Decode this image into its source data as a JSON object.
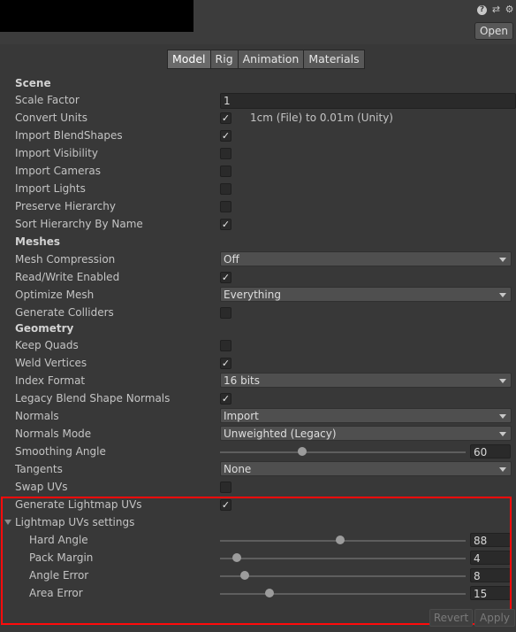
{
  "header": {
    "open_label": "Open",
    "help_icon": "?",
    "preset_icon": "⇄",
    "settings_icon": "⚙"
  },
  "tabs": [
    "Model",
    "Rig",
    "Animation",
    "Materials"
  ],
  "scene": {
    "heading": "Scene",
    "scale_factor": {
      "label": "Scale Factor",
      "value": "1"
    },
    "convert_units": {
      "label": "Convert Units",
      "checked": true,
      "note": "1cm (File) to 0.01m (Unity)"
    },
    "import_blendshapes": {
      "label": "Import BlendShapes",
      "checked": true
    },
    "import_visibility": {
      "label": "Import Visibility",
      "checked": false
    },
    "import_cameras": {
      "label": "Import Cameras",
      "checked": false
    },
    "import_lights": {
      "label": "Import Lights",
      "checked": false
    },
    "preserve_hierarchy": {
      "label": "Preserve Hierarchy",
      "checked": false
    },
    "sort_hierarchy": {
      "label": "Sort Hierarchy By Name",
      "checked": true
    }
  },
  "meshes": {
    "heading": "Meshes",
    "mesh_compression": {
      "label": "Mesh Compression",
      "value": "Off"
    },
    "read_write": {
      "label": "Read/Write Enabled",
      "checked": true
    },
    "optimize_mesh": {
      "label": "Optimize Mesh",
      "value": "Everything"
    },
    "generate_colliders": {
      "label": "Generate Colliders",
      "checked": false
    }
  },
  "geometry": {
    "heading": "Geometry",
    "keep_quads": {
      "label": "Keep Quads",
      "checked": false
    },
    "weld_vertices": {
      "label": "Weld Vertices",
      "checked": true
    },
    "index_format": {
      "label": "Index Format",
      "value": "16 bits"
    },
    "legacy_blend": {
      "label": "Legacy Blend Shape Normals",
      "checked": true
    },
    "normals": {
      "label": "Normals",
      "value": "Import"
    },
    "normals_mode": {
      "label": "Normals Mode",
      "value": "Unweighted (Legacy)"
    },
    "smoothing_angle": {
      "label": "Smoothing Angle",
      "value": "60",
      "fraction": 0.3333
    },
    "tangents": {
      "label": "Tangents",
      "value": "None"
    },
    "swap_uvs": {
      "label": "Swap UVs",
      "checked": false
    },
    "generate_lightmap": {
      "label": "Generate Lightmap UVs",
      "checked": true
    }
  },
  "lightmap": {
    "heading": "Lightmap UVs settings",
    "hard_angle": {
      "label": "Hard Angle",
      "value": "88",
      "fraction": 0.4889
    },
    "pack_margin": {
      "label": "Pack Margin",
      "value": "4",
      "fraction": 0.0667
    },
    "angle_error": {
      "label": "Angle Error",
      "value": "8",
      "fraction": 0.1
    },
    "area_error": {
      "label": "Area Error",
      "value": "15",
      "fraction": 0.2
    }
  },
  "footer": {
    "revert_label": "Revert",
    "apply_label": "Apply"
  },
  "colors": {
    "background": "#383838",
    "highlight": "#ff0b0b",
    "text": "#c4c4c4"
  }
}
